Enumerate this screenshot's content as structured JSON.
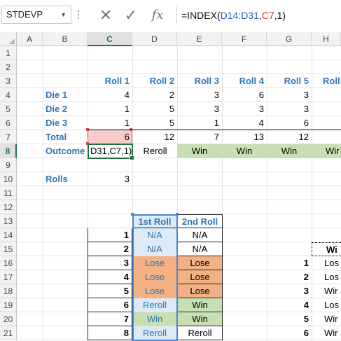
{
  "namebox": {
    "value": "STDEVP"
  },
  "formula_bar": {
    "cancel_symbol": "✕",
    "enter_symbol": "✓",
    "fx_symbol": "fx",
    "prefix": "=INDEX(",
    "ref1": "D14:D31",
    "comma1": ",",
    "ref2": "C7",
    "suffix": ",1)"
  },
  "columns": [
    "A",
    "B",
    "C",
    "D",
    "E",
    "F",
    "G",
    "H"
  ],
  "rows": [
    "1",
    "2",
    "3",
    "4",
    "5",
    "6",
    "7",
    "8",
    "9",
    "10",
    "11",
    "12",
    "13",
    "14",
    "15",
    "16",
    "17",
    "18",
    "19",
    "20",
    "21"
  ],
  "sheet": {
    "roll_headers": [
      "Roll 1",
      "Roll 2",
      "Roll 3",
      "Roll 4",
      "Roll 5",
      "Roll"
    ],
    "labels": {
      "die1": "Die 1",
      "die2": "Die 2",
      "die3": "Die 3",
      "total": "Total",
      "outcome": "Outcome",
      "rolls": "Rolls"
    },
    "die1": [
      "4",
      "2",
      "3",
      "6",
      "3"
    ],
    "die2": [
      "1",
      "5",
      "3",
      "3",
      "3"
    ],
    "die3": [
      "1",
      "5",
      "1",
      "4",
      "6"
    ],
    "total": [
      "6",
      "12",
      "7",
      "13",
      "12"
    ],
    "outcome": [
      "D31,C7,1)",
      "Reroll",
      "Win",
      "Win",
      "Win",
      "Wir"
    ],
    "rolls_value": "3"
  },
  "table": {
    "header": [
      "1st Roll",
      "2nd Roll"
    ],
    "rows": [
      {
        "n": "1",
        "first": "N/A",
        "second": "N/A"
      },
      {
        "n": "2",
        "first": "N/A",
        "second": "N/A"
      },
      {
        "n": "3",
        "first": "Lose",
        "second": "Lose"
      },
      {
        "n": "4",
        "first": "Lose",
        "second": "Lose"
      },
      {
        "n": "5",
        "first": "Lose",
        "second": "Lose"
      },
      {
        "n": "6",
        "first": "Reroll",
        "second": "Win"
      },
      {
        "n": "7",
        "first": "Win",
        "second": "Win"
      },
      {
        "n": "8",
        "first": "Reroll",
        "second": "Reroll"
      }
    ]
  },
  "side_table": {
    "header": "Wi",
    "rows": [
      {
        "n": "1",
        "v": "Los"
      },
      {
        "n": "2",
        "v": "Los"
      },
      {
        "n": "3",
        "v": "Wir"
      },
      {
        "n": "4",
        "v": "Los"
      },
      {
        "n": "5",
        "v": "Wir"
      },
      {
        "n": "6",
        "v": "Wir"
      }
    ]
  }
}
